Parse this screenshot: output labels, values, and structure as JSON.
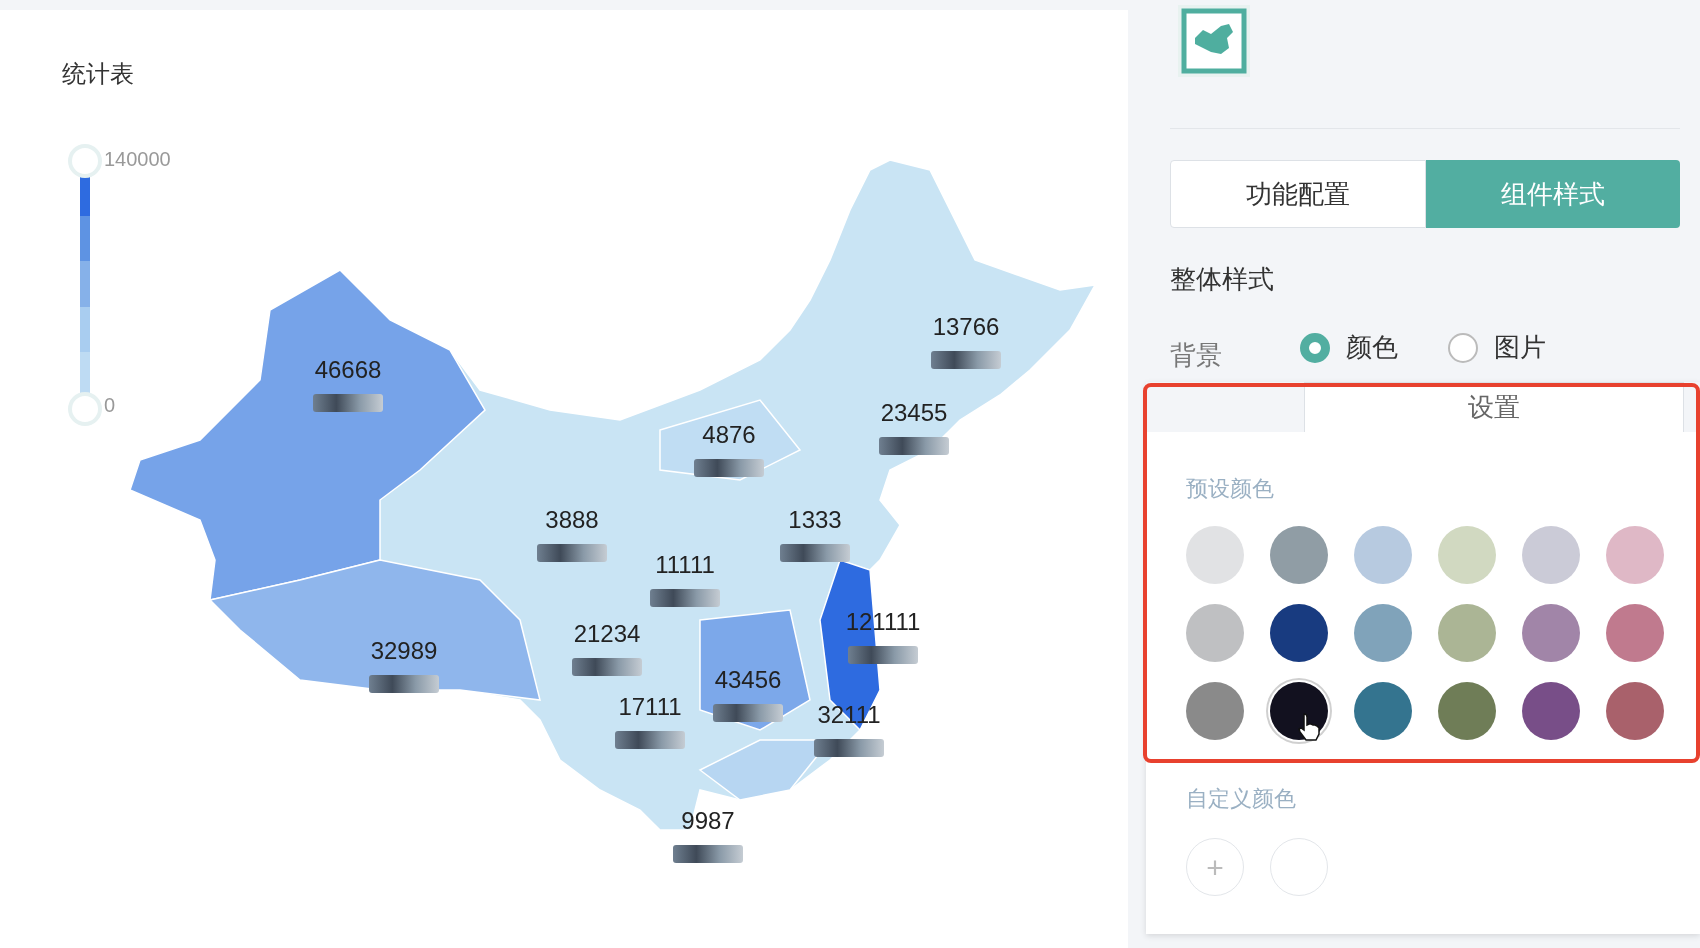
{
  "card": {
    "title": "统计表"
  },
  "legend": {
    "max": "140000",
    "min": "0"
  },
  "map": {
    "regions": [
      {
        "value": "46668"
      },
      {
        "value": "13766"
      },
      {
        "value": "23455"
      },
      {
        "value": "4876"
      },
      {
        "value": "3888"
      },
      {
        "value": "1333"
      },
      {
        "value": "11111"
      },
      {
        "value": "121111"
      },
      {
        "value": "21234"
      },
      {
        "value": "32989"
      },
      {
        "value": "43456"
      },
      {
        "value": "17111"
      },
      {
        "value": "32111"
      },
      {
        "value": "9987"
      }
    ]
  },
  "panel": {
    "tabs": [
      {
        "label": "功能配置",
        "selected": false
      },
      {
        "label": "组件样式",
        "selected": true
      }
    ],
    "section_title": "整体样式",
    "background": {
      "label": "背景",
      "options": [
        {
          "label": "颜色",
          "selected": true
        },
        {
          "label": "图片",
          "selected": false
        }
      ]
    },
    "popover": {
      "tab": "设置",
      "preset_label": "预设颜色",
      "swatches": [
        {
          "color": "#e1e2e4",
          "hovered": false
        },
        {
          "color": "#909da5",
          "hovered": false
        },
        {
          "color": "#b7cae0",
          "hovered": false
        },
        {
          "color": "#d1d9c1",
          "hovered": false
        },
        {
          "color": "#cbcbd7",
          "hovered": false
        },
        {
          "color": "#dfb8c6",
          "hovered": false
        },
        {
          "color": "#bfc0c2",
          "hovered": false
        },
        {
          "color": "#183b80",
          "hovered": false
        },
        {
          "color": "#80a3ba",
          "hovered": false
        },
        {
          "color": "#abb595",
          "hovered": false
        },
        {
          "color": "#a185a8",
          "hovered": false
        },
        {
          "color": "#c07a8e",
          "hovered": false
        },
        {
          "color": "#8a8a8a",
          "hovered": false
        },
        {
          "color": "#12111f",
          "hovered": true
        },
        {
          "color": "#34748f",
          "hovered": false
        },
        {
          "color": "#6f7d57",
          "hovered": false
        },
        {
          "color": "#784e88",
          "hovered": false
        },
        {
          "color": "#a9616b",
          "hovered": false
        }
      ],
      "custom_label": "自定义颜色",
      "add_button": "+"
    }
  }
}
